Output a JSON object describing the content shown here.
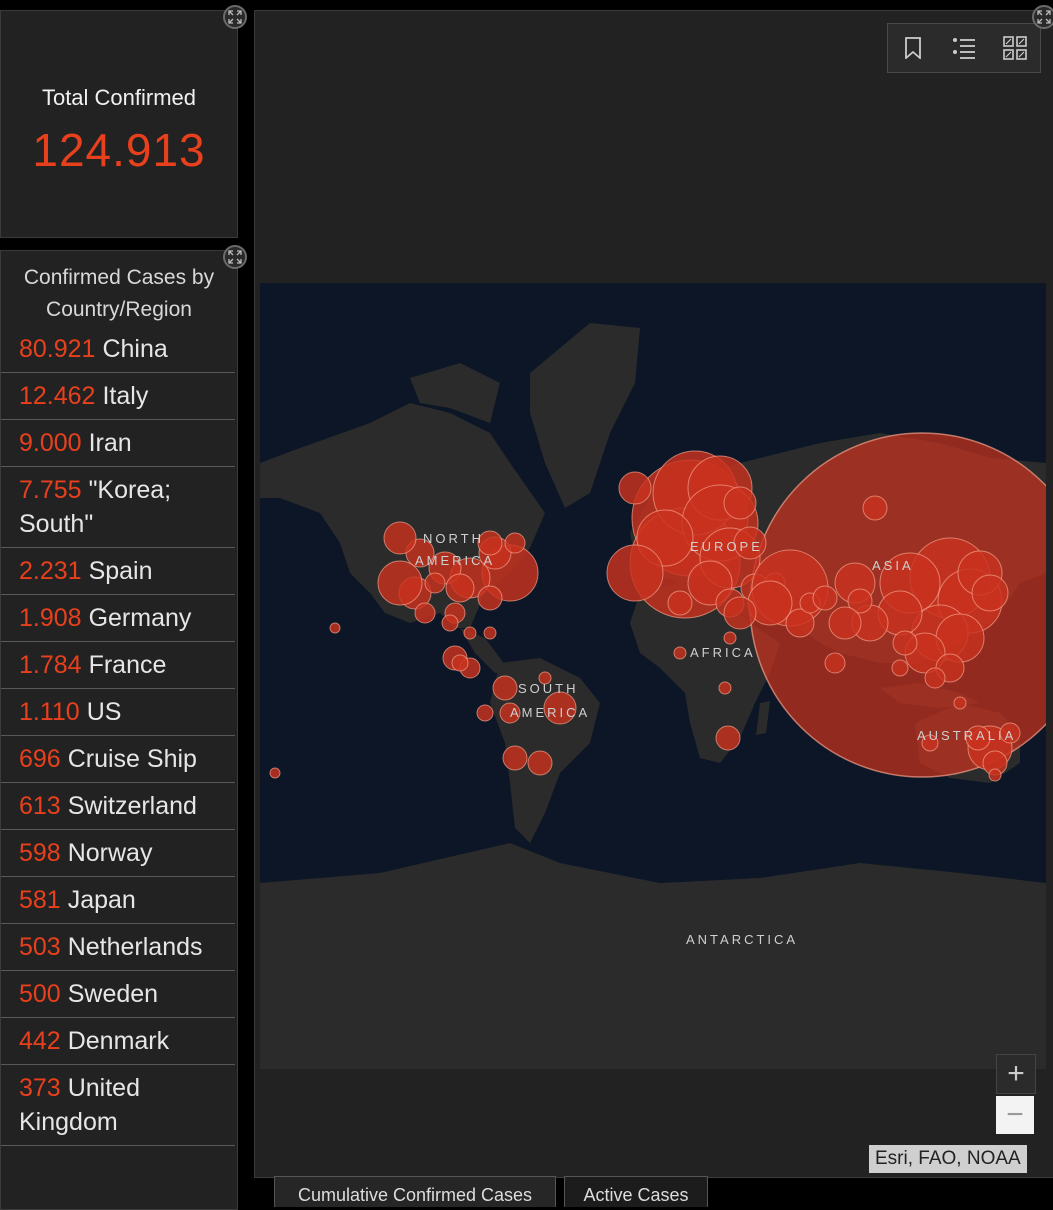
{
  "total": {
    "label": "Total Confirmed",
    "value": "124.913"
  },
  "list": {
    "heading_line1": "Confirmed Cases by",
    "heading_line2": "Country/Region",
    "rows": [
      {
        "num": "80.921",
        "name": "China"
      },
      {
        "num": "12.462",
        "name": "Italy"
      },
      {
        "num": "9.000",
        "name": "Iran"
      },
      {
        "num": "7.755",
        "name": "\"Korea; South\""
      },
      {
        "num": "2.231",
        "name": "Spain"
      },
      {
        "num": "1.908",
        "name": "Germany"
      },
      {
        "num": "1.784",
        "name": "France"
      },
      {
        "num": "1.110",
        "name": "US"
      },
      {
        "num": "696",
        "name": "Cruise Ship"
      },
      {
        "num": "613",
        "name": "Switzerland"
      },
      {
        "num": "598",
        "name": "Norway"
      },
      {
        "num": "581",
        "name": "Japan"
      },
      {
        "num": "503",
        "name": "Netherlands"
      },
      {
        "num": "500",
        "name": "Sweden"
      },
      {
        "num": "442",
        "name": "Denmark"
      },
      {
        "num": "373",
        "name": "United Kingdom"
      }
    ]
  },
  "map": {
    "labels": {
      "north_america_1": "NORTH",
      "north_america_2": "AMERICA",
      "europe": "EUROPE",
      "asia": "ASIA",
      "africa": "AFRICA",
      "south_america_1": "SOUTH",
      "south_america_2": "AMERICA",
      "australia": "AUSTRALIA",
      "antarctica": "ANTARCTICA"
    },
    "attribution": "Esri, FAO, NOAA",
    "zoom_in": "+",
    "zoom_out": "−"
  },
  "tabs": [
    {
      "label": "Cumulative Confirmed Cases"
    },
    {
      "label": "Active Cases"
    }
  ],
  "colors": {
    "accent": "#e8401c",
    "bubble": "#c8321e",
    "land": "#2b2b2b",
    "water": "#0c1626"
  }
}
